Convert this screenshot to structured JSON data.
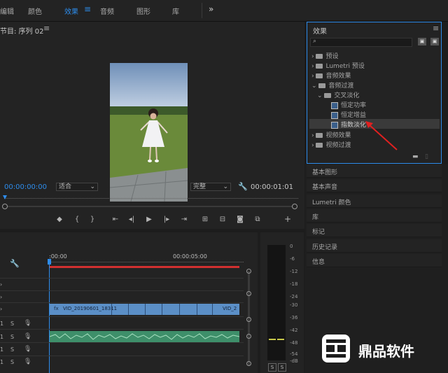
{
  "workspace_tabs": [
    {
      "label": "编辑",
      "active": false
    },
    {
      "label": "颜色",
      "active": false
    },
    {
      "label": "效果",
      "active": true
    },
    {
      "label": "音频",
      "active": false
    },
    {
      "label": "图形",
      "active": false
    },
    {
      "label": "库",
      "active": false
    }
  ],
  "program_monitor": {
    "title": "节目: 序列 02",
    "current_time": "00:00:00:00",
    "fit_option": "适合",
    "quality_option": "完整",
    "duration": "00:00:01:01"
  },
  "effects_panel": {
    "title": "效果",
    "search_value": "",
    "tree": [
      {
        "label": "预设",
        "type": "folder",
        "level": 0,
        "expanded": false
      },
      {
        "label": "Lumetri 预设",
        "type": "folder",
        "level": 0,
        "expanded": false
      },
      {
        "label": "音频效果",
        "type": "folder",
        "level": 0,
        "expanded": false
      },
      {
        "label": "音频过渡",
        "type": "folder",
        "level": 0,
        "expanded": true
      },
      {
        "label": "交叉淡化",
        "type": "folder",
        "level": 1,
        "expanded": true
      },
      {
        "label": "恒定功率",
        "type": "effect",
        "level": 2
      },
      {
        "label": "恒定增益",
        "type": "effect",
        "level": 2
      },
      {
        "label": "指数淡化",
        "type": "effect",
        "level": 2,
        "selected": true
      },
      {
        "label": "视频效果",
        "type": "folder",
        "level": 0,
        "expanded": false
      },
      {
        "label": "视频过渡",
        "type": "folder",
        "level": 0,
        "expanded": false
      }
    ]
  },
  "side_panels": [
    {
      "label": "基本图形"
    },
    {
      "label": "基本声音"
    },
    {
      "label": "Lumetri 颜色"
    },
    {
      "label": "库"
    },
    {
      "label": "标记"
    },
    {
      "label": "历史记录"
    },
    {
      "label": "信息"
    }
  ],
  "timeline": {
    "ruler_start": ":00:00",
    "ruler_mark": "00:00:05:00",
    "video_clip_name": "VID_20190601_18311",
    "video_clip_end_name": "VID_2",
    "audio_solo_label": "S"
  },
  "audio_meter": {
    "scale": [
      "0",
      "-6",
      "-12",
      "-18",
      "-24",
      "-30",
      "-36",
      "-42",
      "-48",
      "-54",
      "-dB"
    ],
    "solo_labels": [
      "S",
      "S"
    ]
  },
  "watermark": {
    "text": "鼎品软件"
  },
  "colors": {
    "accent": "#2d8ceb",
    "clip_video": "#5b8fc7",
    "clip_audio": "#3e8f6a",
    "playhead_bar": "#d03030"
  }
}
